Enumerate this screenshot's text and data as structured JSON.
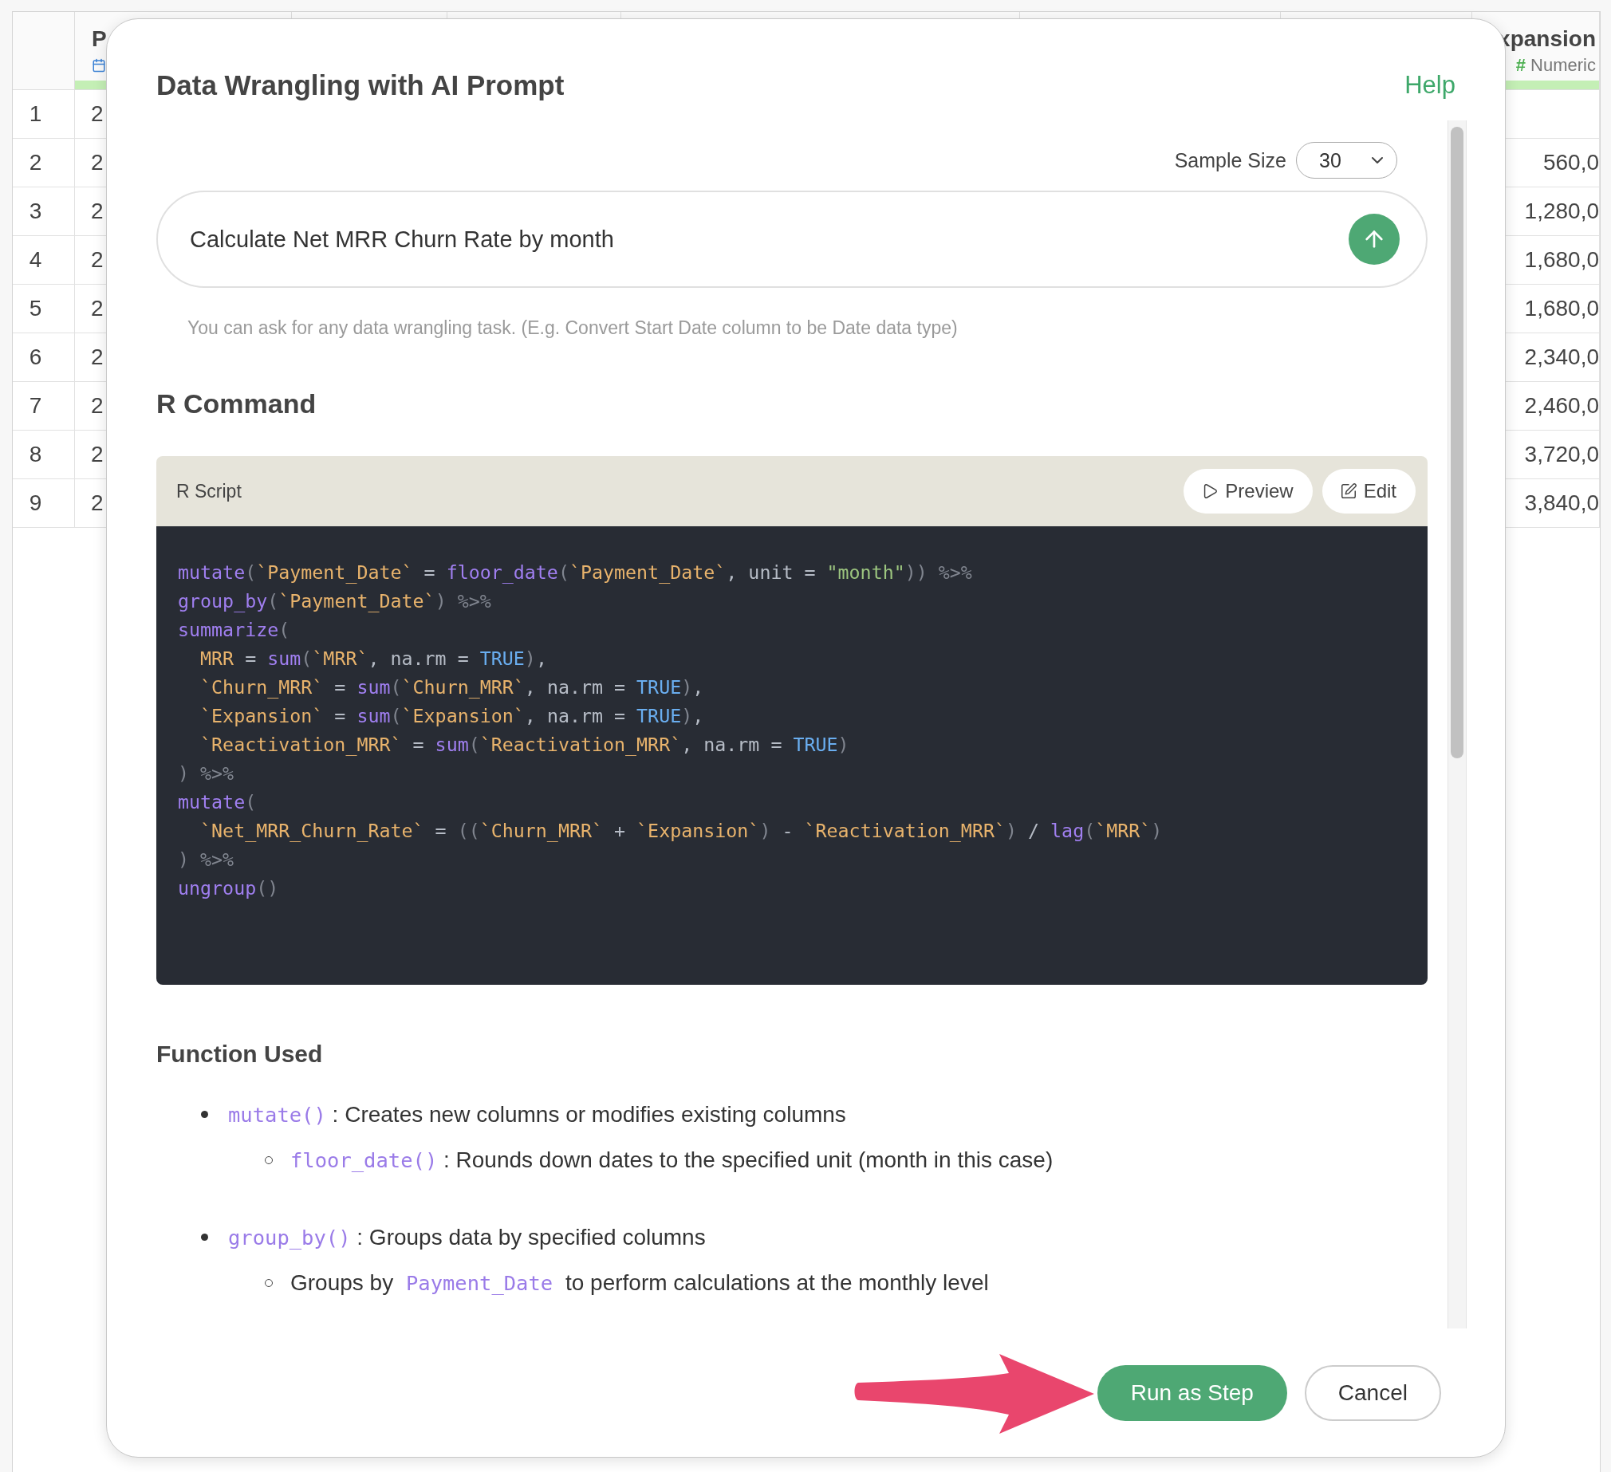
{
  "table": {
    "columns": [
      {
        "name": "P",
        "level": 1
      },
      {
        "name": "xpansion",
        "type_mark": "#",
        "type_label": "Numeric",
        "level": 1
      }
    ],
    "rows": [
      {
        "number": "1",
        "left_cell": "2"
      },
      {
        "number": "2",
        "left_cell": "2",
        "right_cell": "560,0"
      },
      {
        "number": "3",
        "left_cell": "2",
        "right_cell": "1,280,0"
      },
      {
        "number": "4",
        "left_cell": "2",
        "right_cell": "1,680,0"
      },
      {
        "number": "5",
        "left_cell": "2",
        "right_cell": "1,680,0"
      },
      {
        "number": "6",
        "left_cell": "2",
        "right_cell": "2,340,0"
      },
      {
        "number": "7",
        "left_cell": "2",
        "right_cell": "2,460,0"
      },
      {
        "number": "8",
        "left_cell": "2",
        "right_cell": "3,720,0"
      },
      {
        "number": "9",
        "left_cell": "2",
        "right_cell": "3,840,0"
      }
    ]
  },
  "dialog": {
    "title": "Data Wrangling with AI Prompt",
    "help": "Help",
    "sample_size": {
      "label": "Sample Size",
      "value": "30"
    },
    "prompt": {
      "value": "Calculate Net MRR Churn Rate by month"
    },
    "hint": "You can ask for any data wrangling task. (E.g. Convert Start Date column to be Date data type)",
    "command_heading": "R Command",
    "script": {
      "title": "R Script",
      "buttons": [
        {
          "kind": "preview",
          "label": "Preview"
        },
        {
          "kind": "edit",
          "label": "Edit"
        }
      ],
      "lines": [
        [
          {
            "kind": "fn",
            "text": "mutate"
          },
          {
            "kind": "punct",
            "text": "("
          },
          {
            "kind": "id",
            "text": "`Payment_Date`"
          },
          {
            "kind": "plain",
            "text": " = "
          },
          {
            "kind": "fn",
            "text": "floor_date"
          },
          {
            "kind": "punct",
            "text": "("
          },
          {
            "kind": "id",
            "text": "`Payment_Date`"
          },
          {
            "kind": "plain",
            "text": ", unit = "
          },
          {
            "kind": "str",
            "text": "\"month\""
          },
          {
            "kind": "punct",
            "text": ")) %>%"
          }
        ],
        [
          {
            "kind": "fn",
            "text": "group_by"
          },
          {
            "kind": "punct",
            "text": "("
          },
          {
            "kind": "id",
            "text": "`Payment_Date`"
          },
          {
            "kind": "punct",
            "text": ") %>%"
          }
        ],
        [
          {
            "kind": "fn",
            "text": "summarize"
          },
          {
            "kind": "punct",
            "text": "("
          }
        ],
        [
          {
            "kind": "id",
            "text": "  MRR"
          },
          {
            "kind": "plain",
            "text": " = "
          },
          {
            "kind": "fn",
            "text": "sum"
          },
          {
            "kind": "punct",
            "text": "("
          },
          {
            "kind": "id",
            "text": "`MRR`"
          },
          {
            "kind": "plain",
            "text": ", na.rm = "
          },
          {
            "kind": "kw",
            "text": "TRUE"
          },
          {
            "kind": "punct",
            "text": ")"
          },
          {
            "kind": "plain",
            "text": ","
          }
        ],
        [
          {
            "kind": "id",
            "text": "  `Churn_MRR`"
          },
          {
            "kind": "plain",
            "text": " = "
          },
          {
            "kind": "fn",
            "text": "sum"
          },
          {
            "kind": "punct",
            "text": "("
          },
          {
            "kind": "id",
            "text": "`Churn_MRR`"
          },
          {
            "kind": "plain",
            "text": ", na.rm = "
          },
          {
            "kind": "kw",
            "text": "TRUE"
          },
          {
            "kind": "punct",
            "text": ")"
          },
          {
            "kind": "plain",
            "text": ","
          }
        ],
        [
          {
            "kind": "id",
            "text": "  `Expansion`"
          },
          {
            "kind": "plain",
            "text": " = "
          },
          {
            "kind": "fn",
            "text": "sum"
          },
          {
            "kind": "punct",
            "text": "("
          },
          {
            "kind": "id",
            "text": "`Expansion`"
          },
          {
            "kind": "plain",
            "text": ", na.rm = "
          },
          {
            "kind": "kw",
            "text": "TRUE"
          },
          {
            "kind": "punct",
            "text": ")"
          },
          {
            "kind": "plain",
            "text": ","
          }
        ],
        [
          {
            "kind": "id",
            "text": "  `Reactivation_MRR`"
          },
          {
            "kind": "plain",
            "text": " = "
          },
          {
            "kind": "fn",
            "text": "sum"
          },
          {
            "kind": "punct",
            "text": "("
          },
          {
            "kind": "id",
            "text": "`Reactivation_MRR`"
          },
          {
            "kind": "plain",
            "text": ", na.rm = "
          },
          {
            "kind": "kw",
            "text": "TRUE"
          },
          {
            "kind": "punct",
            "text": ")"
          }
        ],
        [
          {
            "kind": "punct",
            "text": ") %>%"
          }
        ],
        [
          {
            "kind": "fn",
            "text": "mutate"
          },
          {
            "kind": "punct",
            "text": "("
          }
        ],
        [
          {
            "kind": "id",
            "text": "  `Net_MRR_Churn_Rate`"
          },
          {
            "kind": "plain",
            "text": " = "
          },
          {
            "kind": "punct",
            "text": "(("
          },
          {
            "kind": "id",
            "text": "`Churn_MRR`"
          },
          {
            "kind": "plain",
            "text": " + "
          },
          {
            "kind": "id",
            "text": "`Expansion`"
          },
          {
            "kind": "punct",
            "text": ")"
          },
          {
            "kind": "plain",
            "text": " - "
          },
          {
            "kind": "id",
            "text": "`Reactivation_MRR`"
          },
          {
            "kind": "punct",
            "text": ")"
          },
          {
            "kind": "plain",
            "text": " / "
          },
          {
            "kind": "fn",
            "text": "lag"
          },
          {
            "kind": "punct",
            "text": "("
          },
          {
            "kind": "id",
            "text": "`MRR`"
          },
          {
            "kind": "punct",
            "text": ")"
          }
        ],
        [
          {
            "kind": "punct",
            "text": ") %>%"
          }
        ],
        [
          {
            "kind": "fn",
            "text": "ungroup"
          },
          {
            "kind": "punct",
            "text": "()"
          }
        ]
      ]
    },
    "functions_heading": "Function Used",
    "functions": [
      {
        "parts": [
          {
            "kind": "code",
            "text": "mutate()"
          },
          {
            "kind": "text",
            "text": " : Creates new columns or modifies existing columns"
          }
        ],
        "children": [
          {
            "parts": [
              {
                "kind": "code",
                "text": "floor_date()"
              },
              {
                "kind": "text",
                "text": " : Rounds down dates to the specified unit (month in this case)"
              }
            ]
          }
        ]
      },
      {
        "parts": [
          {
            "kind": "code",
            "text": "group_by()"
          },
          {
            "kind": "text",
            "text": " : Groups data by specified columns"
          }
        ],
        "children": [
          {
            "parts": [
              {
                "kind": "text",
                "text": "Groups by "
              },
              {
                "kind": "code",
                "text": "Payment_Date"
              },
              {
                "kind": "text",
                "text": " to perform calculations at the monthly level"
              }
            ]
          }
        ]
      }
    ],
    "buttons": [
      {
        "kind": "primary",
        "label": "Run as Step"
      },
      {
        "kind": "secondary",
        "label": "Cancel"
      }
    ]
  }
}
